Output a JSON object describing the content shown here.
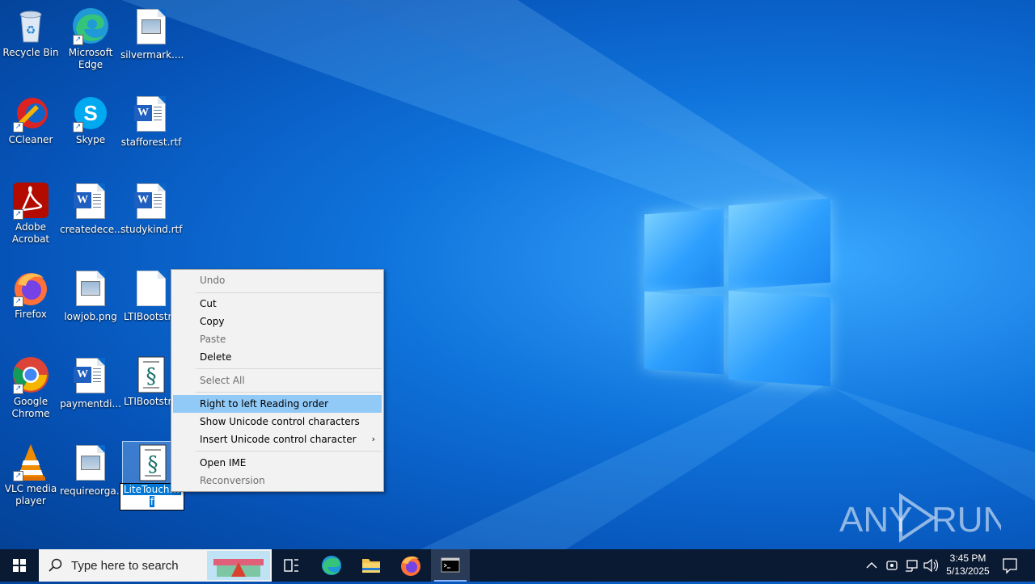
{
  "desktop": {
    "icons": [
      {
        "label": "Recycle Bin"
      },
      {
        "label": "Microsoft Edge"
      },
      {
        "label": "silvermark...."
      },
      {
        "label": "CCleaner"
      },
      {
        "label": "Skype"
      },
      {
        "label": "stafforest.rtf"
      },
      {
        "label": "Adobe Acrobat"
      },
      {
        "label": "createdece..."
      },
      {
        "label": "studykind.rtf"
      },
      {
        "label": "Firefox"
      },
      {
        "label": "lowjob.png"
      },
      {
        "label": "LTIBootstra"
      },
      {
        "label": "Google Chrome"
      },
      {
        "label": "paymentdi..."
      },
      {
        "label": "LTIBootstra"
      },
      {
        "label": "VLC media player"
      },
      {
        "label": "requireorga..."
      }
    ],
    "rename": {
      "selected_text": "LiteTouch.w",
      "rest": "f"
    }
  },
  "context_menu": {
    "items": [
      {
        "label": "Undo"
      },
      {
        "label": "Cut"
      },
      {
        "label": "Copy"
      },
      {
        "label": "Paste"
      },
      {
        "label": "Delete"
      },
      {
        "label": "Select All"
      },
      {
        "label": "Right to left Reading order"
      },
      {
        "label": "Show Unicode control characters"
      },
      {
        "label": "Insert Unicode control character",
        "arrow": "›"
      },
      {
        "label": "Open IME"
      },
      {
        "label": "Reconversion"
      }
    ]
  },
  "taskbar": {
    "search_placeholder": "Type here to search",
    "clock_time": "3:45 PM",
    "clock_date": "5/13/2025"
  },
  "watermark": {
    "text": "ANY RUN"
  },
  "colors": {
    "menu_highlight": "#91c9f7",
    "taskbar": "#0b1a33",
    "selection": "#0078d7"
  }
}
